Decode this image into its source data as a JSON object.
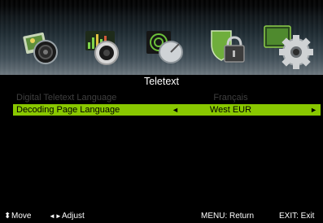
{
  "menu_icons": [
    {
      "name": "picture-icon"
    },
    {
      "name": "sound-icon"
    },
    {
      "name": "channel-icon"
    },
    {
      "name": "lock-icon"
    },
    {
      "name": "setup-gear-icon",
      "selected": true
    }
  ],
  "page": {
    "title": "Teletext"
  },
  "items": [
    {
      "label": "Digital Teletext Language",
      "value": "Français",
      "enabled": false
    },
    {
      "label": "Decoding Page Language",
      "value": "West EUR",
      "selected": true,
      "left_arrow": "◄",
      "right_arrow": "►"
    }
  ],
  "footer": {
    "move_icon": "⬍",
    "move_label": "Move",
    "adjust_icon": "◄►",
    "adjust_label": "Adjust",
    "menu_label": "MENU: Return",
    "exit_label": "EXIT: Exit"
  },
  "colors": {
    "highlight": "#89c800",
    "disabled_text": "#3f3f3f"
  }
}
